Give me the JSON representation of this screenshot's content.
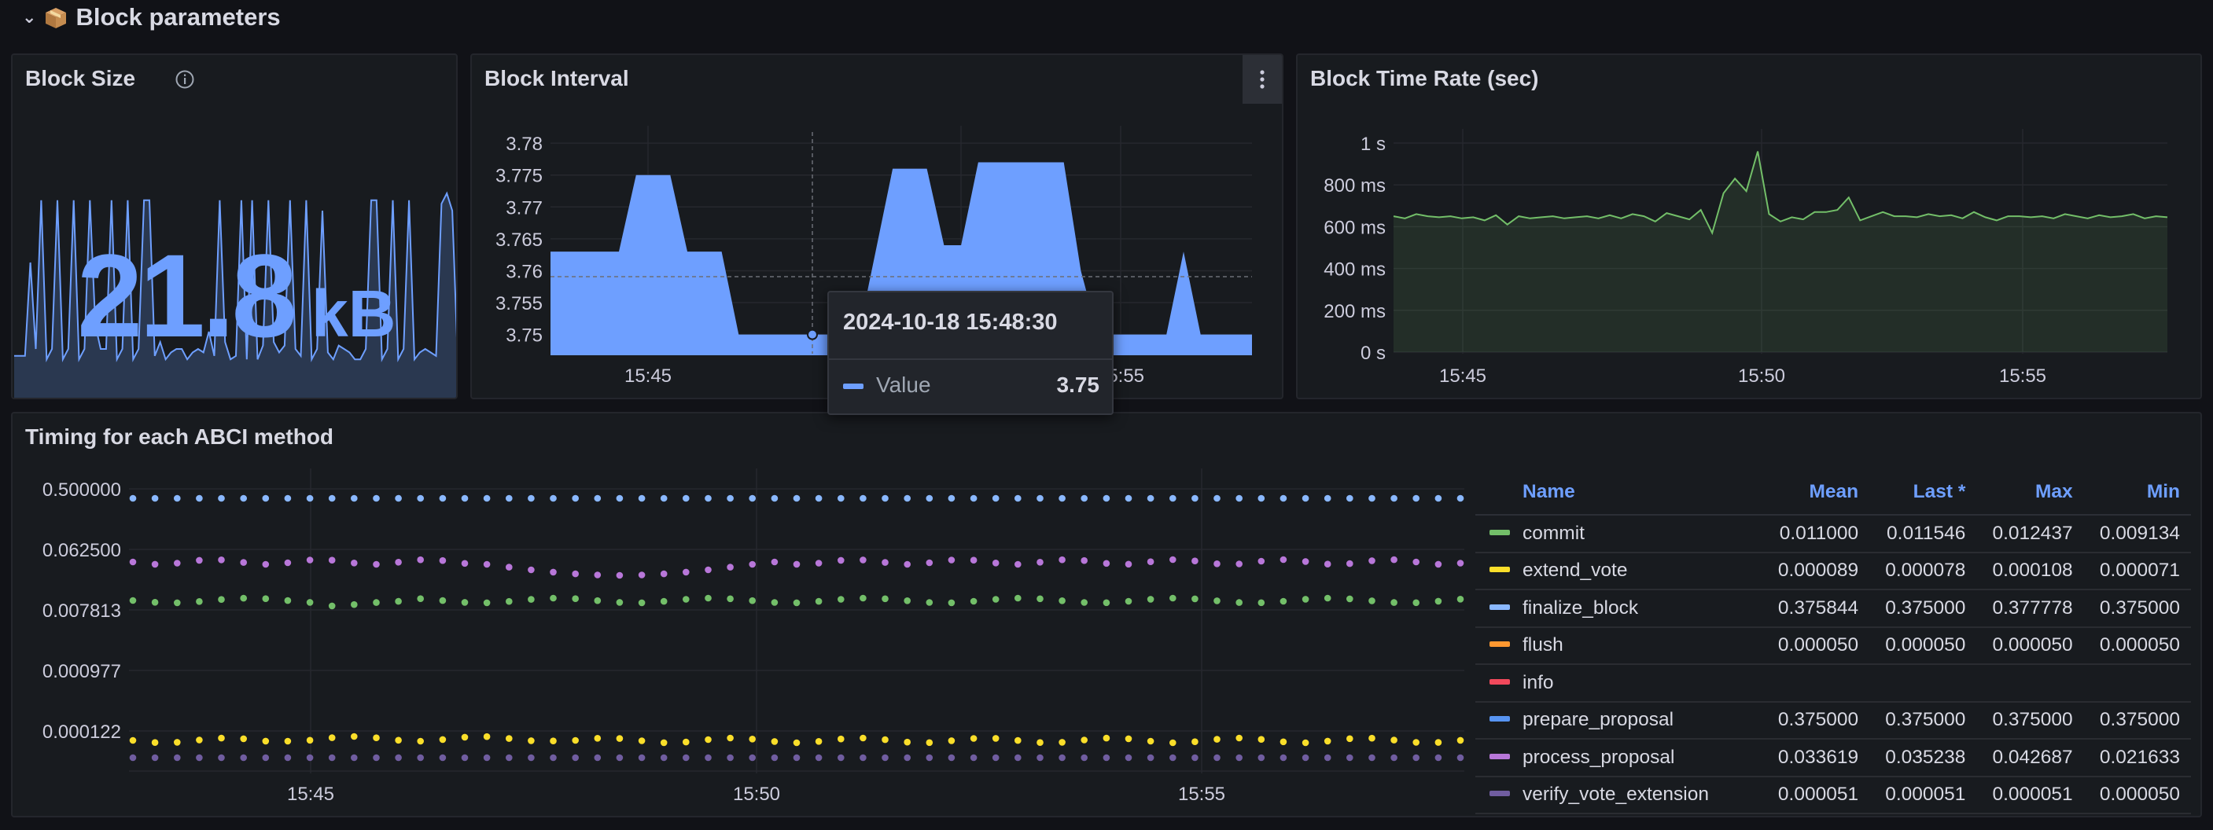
{
  "row": {
    "title": "Block parameters",
    "collapse_icon": "chevron-down-icon",
    "emoji_icon": "package-icon"
  },
  "block_size": {
    "title": "Block Size",
    "value": "21.8",
    "unit": "kB",
    "color": "#6e9fff",
    "sparkline": [
      13,
      13,
      13,
      40,
      15,
      58,
      12,
      15,
      58,
      12,
      15,
      58,
      12,
      15,
      58,
      22,
      15,
      15,
      58,
      12,
      15,
      58,
      12,
      15,
      58,
      58,
      13,
      17,
      12,
      14,
      15,
      15,
      12,
      14,
      15,
      14,
      20,
      13,
      58,
      17,
      12,
      13,
      58,
      12,
      58,
      12,
      16,
      58,
      17,
      14,
      16,
      58,
      15,
      13,
      58,
      12,
      15,
      55,
      14,
      12,
      16,
      15,
      14,
      12,
      12,
      15,
      58,
      58,
      12,
      15,
      58,
      12,
      15,
      58,
      12,
      14,
      15,
      14,
      13,
      57,
      60,
      55,
      12
    ]
  },
  "block_interval": {
    "title": "Block Interval",
    "menu_icon": "kebab-menu-icon",
    "color": "#6e9fff",
    "y_ticks": [
      "3.78",
      "3.775",
      "3.77",
      "3.765",
      "3.76",
      "3.755",
      "3.75"
    ],
    "x_ticks": [
      "15:45",
      "15:50",
      "15:55"
    ],
    "tooltip": {
      "time": "2024-10-18 15:48:30",
      "label": "Value",
      "value": "3.75"
    }
  },
  "block_time_rate": {
    "title": "Block Time Rate (sec)",
    "line_color": "#73bf69",
    "y_ticks": [
      "1 s",
      "800 ms",
      "600 ms",
      "400 ms",
      "200 ms",
      "0 s"
    ],
    "x_ticks": [
      "15:45",
      "15:50",
      "15:55"
    ]
  },
  "abci": {
    "title": "Timing for each ABCI method",
    "y_ticks": [
      "0.500000",
      "0.062500",
      "0.007813",
      "0.000977",
      "0.000122"
    ],
    "x_ticks": [
      "15:45",
      "15:50",
      "15:55"
    ],
    "legend_headers": {
      "name": "Name",
      "mean": "Mean",
      "last": "Last *",
      "max": "Max",
      "min": "Min"
    },
    "legend": [
      {
        "name": "commit",
        "color": "#73bf69",
        "mean": "0.011000",
        "last": "0.011546",
        "max": "0.012437",
        "min": "0.009134"
      },
      {
        "name": "extend_vote",
        "color": "#fade2a",
        "mean": "0.000089",
        "last": "0.000078",
        "max": "0.000108",
        "min": "0.000071"
      },
      {
        "name": "finalize_block",
        "color": "#8ab8ff",
        "mean": "0.375844",
        "last": "0.375000",
        "max": "0.377778",
        "min": "0.375000"
      },
      {
        "name": "flush",
        "color": "#ff9830",
        "mean": "0.000050",
        "last": "0.000050",
        "max": "0.000050",
        "min": "0.000050"
      },
      {
        "name": "info",
        "color": "#f2495c",
        "mean": "",
        "last": "",
        "max": "",
        "min": ""
      },
      {
        "name": "prepare_proposal",
        "color": "#5794f2",
        "mean": "0.375000",
        "last": "0.375000",
        "max": "0.375000",
        "min": "0.375000"
      },
      {
        "name": "process_proposal",
        "color": "#b877d9",
        "mean": "0.033619",
        "last": "0.035238",
        "max": "0.042687",
        "min": "0.021633"
      },
      {
        "name": "verify_vote_extension",
        "color": "#705da0",
        "mean": "0.000051",
        "last": "0.000051",
        "max": "0.000051",
        "min": "0.000050"
      }
    ]
  },
  "chart_data": [
    {
      "type": "line",
      "title": "Block Size",
      "unit": "kB",
      "current_value": 21.8
    },
    {
      "type": "area",
      "title": "Block Interval",
      "xlabel": "",
      "ylabel": "",
      "x_ticks": [
        "15:45",
        "15:50",
        "15:55"
      ],
      "ylim": [
        3.747,
        3.781
      ],
      "series": [
        {
          "values": [
            3.763,
            3.763,
            3.763,
            3.763,
            3.763,
            3.775,
            3.775,
            3.775,
            3.763,
            3.763,
            3.763,
            3.75,
            3.75,
            3.75,
            3.75,
            3.75,
            3.75,
            3.75,
            3.75,
            3.763,
            3.776,
            3.776,
            3.776,
            3.764,
            3.764,
            3.777,
            3.777,
            3.777,
            3.777,
            3.777,
            3.777,
            3.76,
            3.75,
            3.75,
            3.75,
            3.75,
            3.75,
            3.763,
            3.75,
            3.75,
            3.75,
            3.75
          ]
        }
      ],
      "tooltip_point": {
        "time": "2024-10-18 15:48:30",
        "value": 3.75
      }
    },
    {
      "type": "line",
      "title": "Block Time Rate (sec)",
      "x_ticks": [
        "15:45",
        "15:50",
        "15:55"
      ],
      "ylim": [
        0,
        1000
      ],
      "y_unit": "ms",
      "series": [
        {
          "values": [
            650,
            640,
            660,
            650,
            645,
            650,
            640,
            645,
            630,
            655,
            610,
            650,
            640,
            645,
            650,
            640,
            645,
            650,
            640,
            655,
            640,
            660,
            650,
            625,
            665,
            650,
            635,
            680,
            570,
            760,
            830,
            770,
            960,
            660,
            625,
            645,
            635,
            670,
            670,
            680,
            740,
            630,
            650,
            670,
            650,
            650,
            645,
            660,
            650,
            655,
            640,
            670,
            645,
            630,
            650,
            650,
            645,
            650,
            640,
            660,
            650,
            640,
            655,
            645,
            650,
            660,
            640,
            650,
            645
          ]
        }
      ]
    },
    {
      "type": "scatter",
      "title": "Timing for each ABCI method",
      "x_ticks": [
        "15:45",
        "15:50",
        "15:55"
      ],
      "y_scale": "log2",
      "y_ticks": [
        0.5,
        0.0625,
        0.007813,
        0.000977,
        0.000122
      ],
      "series": [
        {
          "name": "finalize_block",
          "level": 0.3758
        },
        {
          "name": "prepare_proposal",
          "level": 0.375
        },
        {
          "name": "process_proposal",
          "level": 0.0336
        },
        {
          "name": "commit",
          "level": 0.011
        },
        {
          "name": "extend_vote",
          "level": 8.9e-05
        },
        {
          "name": "verify_vote_extension",
          "level": 5.1e-05
        },
        {
          "name": "flush",
          "level": 5e-05
        }
      ]
    }
  ]
}
